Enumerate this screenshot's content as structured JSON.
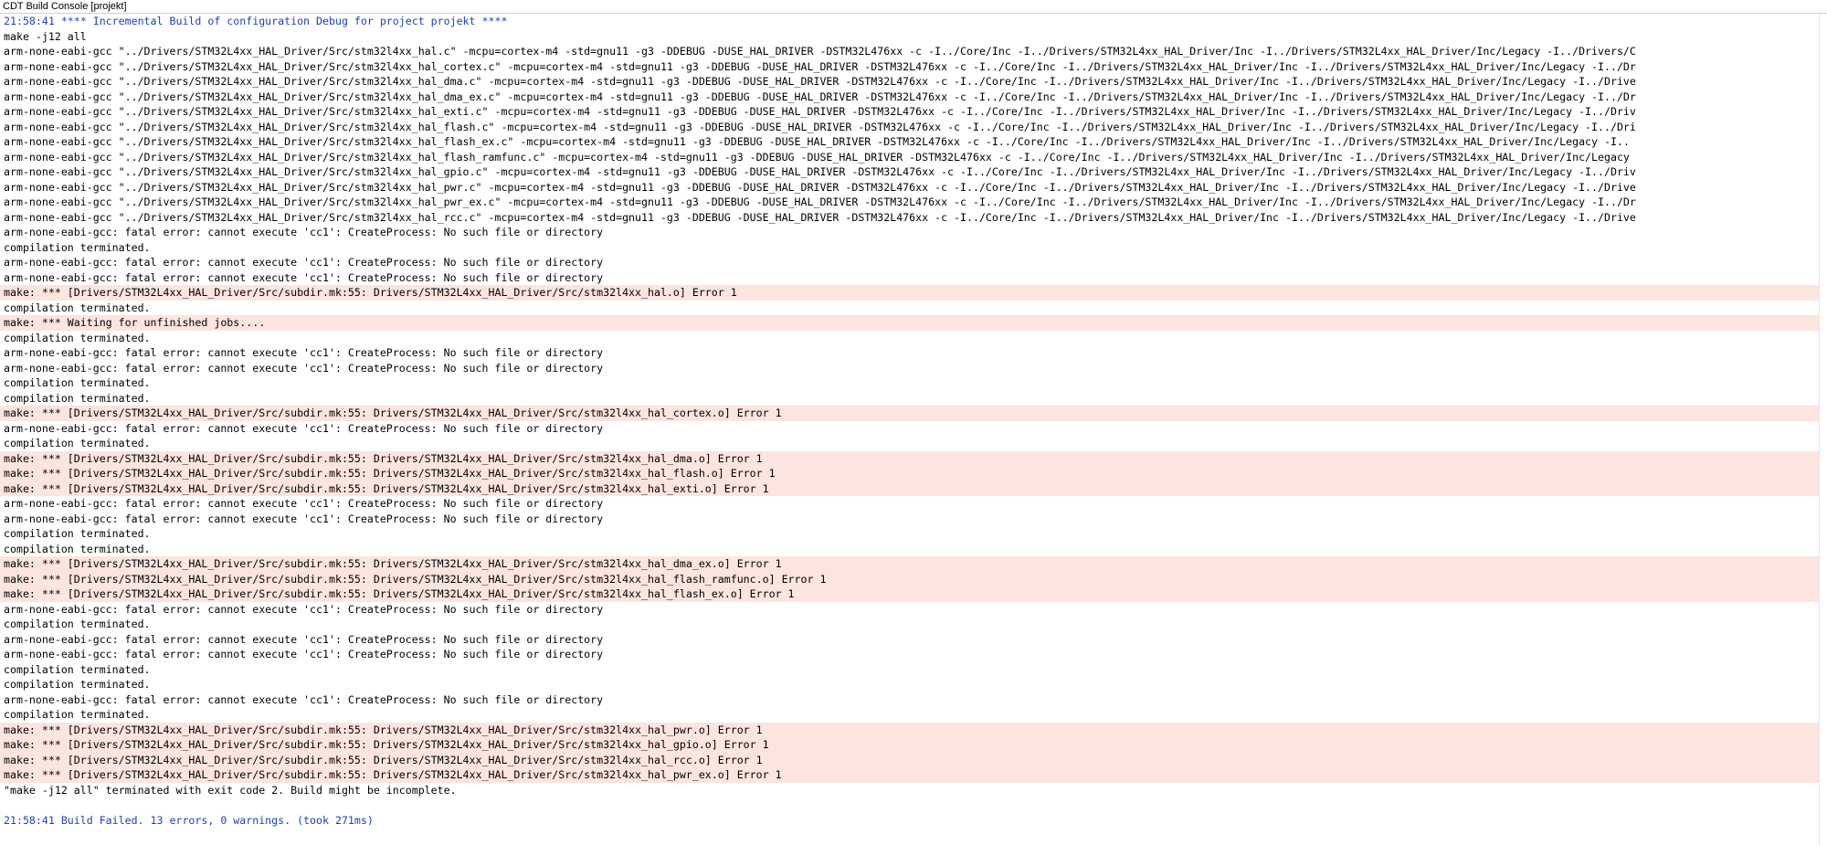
{
  "window": {
    "title": "CDT Build Console [projekt]"
  },
  "console": {
    "lines": [
      {
        "text": "21:58:41 **** Incremental Build of configuration Debug for project projekt ****",
        "kind": "info"
      },
      {
        "text": "make -j12 all",
        "kind": "normal"
      },
      {
        "text": "arm-none-eabi-gcc \"../Drivers/STM32L4xx_HAL_Driver/Src/stm32l4xx_hal.c\" -mcpu=cortex-m4 -std=gnu11 -g3 -DDEBUG -DUSE_HAL_DRIVER -DSTM32L476xx -c -I../Core/Inc -I../Drivers/STM32L4xx_HAL_Driver/Inc -I../Drivers/STM32L4xx_HAL_Driver/Inc/Legacy -I../Drivers/C",
        "kind": "normal"
      },
      {
        "text": "arm-none-eabi-gcc \"../Drivers/STM32L4xx_HAL_Driver/Src/stm32l4xx_hal_cortex.c\" -mcpu=cortex-m4 -std=gnu11 -g3 -DDEBUG -DUSE_HAL_DRIVER -DSTM32L476xx -c -I../Core/Inc -I../Drivers/STM32L4xx_HAL_Driver/Inc -I../Drivers/STM32L4xx_HAL_Driver/Inc/Legacy -I../Dr",
        "kind": "normal"
      },
      {
        "text": "arm-none-eabi-gcc \"../Drivers/STM32L4xx_HAL_Driver/Src/stm32l4xx_hal_dma.c\" -mcpu=cortex-m4 -std=gnu11 -g3 -DDEBUG -DUSE_HAL_DRIVER -DSTM32L476xx -c -I../Core/Inc -I../Drivers/STM32L4xx_HAL_Driver/Inc -I../Drivers/STM32L4xx_HAL_Driver/Inc/Legacy -I../Drive",
        "kind": "normal"
      },
      {
        "text": "arm-none-eabi-gcc \"../Drivers/STM32L4xx_HAL_Driver/Src/stm32l4xx_hal_dma_ex.c\" -mcpu=cortex-m4 -std=gnu11 -g3 -DDEBUG -DUSE_HAL_DRIVER -DSTM32L476xx -c -I../Core/Inc -I../Drivers/STM32L4xx_HAL_Driver/Inc -I../Drivers/STM32L4xx_HAL_Driver/Inc/Legacy -I../Dr",
        "kind": "normal"
      },
      {
        "text": "arm-none-eabi-gcc \"../Drivers/STM32L4xx_HAL_Driver/Src/stm32l4xx_hal_exti.c\" -mcpu=cortex-m4 -std=gnu11 -g3 -DDEBUG -DUSE_HAL_DRIVER -DSTM32L476xx -c -I../Core/Inc -I../Drivers/STM32L4xx_HAL_Driver/Inc -I../Drivers/STM32L4xx_HAL_Driver/Inc/Legacy -I../Driv",
        "kind": "normal"
      },
      {
        "text": "arm-none-eabi-gcc \"../Drivers/STM32L4xx_HAL_Driver/Src/stm32l4xx_hal_flash.c\" -mcpu=cortex-m4 -std=gnu11 -g3 -DDEBUG -DUSE_HAL_DRIVER -DSTM32L476xx -c -I../Core/Inc -I../Drivers/STM32L4xx_HAL_Driver/Inc -I../Drivers/STM32L4xx_HAL_Driver/Inc/Legacy -I../Dri",
        "kind": "normal"
      },
      {
        "text": "arm-none-eabi-gcc \"../Drivers/STM32L4xx_HAL_Driver/Src/stm32l4xx_hal_flash_ex.c\" -mcpu=cortex-m4 -std=gnu11 -g3 -DDEBUG -DUSE_HAL_DRIVER -DSTM32L476xx -c -I../Core/Inc -I../Drivers/STM32L4xx_HAL_Driver/Inc -I../Drivers/STM32L4xx_HAL_Driver/Inc/Legacy -I..",
        "kind": "normal"
      },
      {
        "text": "arm-none-eabi-gcc \"../Drivers/STM32L4xx_HAL_Driver/Src/stm32l4xx_hal_flash_ramfunc.c\" -mcpu=cortex-m4 -std=gnu11 -g3 -DDEBUG -DUSE_HAL_DRIVER -DSTM32L476xx -c -I../Core/Inc -I../Drivers/STM32L4xx_HAL_Driver/Inc -I../Drivers/STM32L4xx_HAL_Driver/Inc/Legacy",
        "kind": "normal"
      },
      {
        "text": "arm-none-eabi-gcc \"../Drivers/STM32L4xx_HAL_Driver/Src/stm32l4xx_hal_gpio.c\" -mcpu=cortex-m4 -std=gnu11 -g3 -DDEBUG -DUSE_HAL_DRIVER -DSTM32L476xx -c -I../Core/Inc -I../Drivers/STM32L4xx_HAL_Driver/Inc -I../Drivers/STM32L4xx_HAL_Driver/Inc/Legacy -I../Driv",
        "kind": "normal"
      },
      {
        "text": "arm-none-eabi-gcc \"../Drivers/STM32L4xx_HAL_Driver/Src/stm32l4xx_hal_pwr.c\" -mcpu=cortex-m4 -std=gnu11 -g3 -DDEBUG -DUSE_HAL_DRIVER -DSTM32L476xx -c -I../Core/Inc -I../Drivers/STM32L4xx_HAL_Driver/Inc -I../Drivers/STM32L4xx_HAL_Driver/Inc/Legacy -I../Drive",
        "kind": "normal"
      },
      {
        "text": "arm-none-eabi-gcc \"../Drivers/STM32L4xx_HAL_Driver/Src/stm32l4xx_hal_pwr_ex.c\" -mcpu=cortex-m4 -std=gnu11 -g3 -DDEBUG -DUSE_HAL_DRIVER -DSTM32L476xx -c -I../Core/Inc -I../Drivers/STM32L4xx_HAL_Driver/Inc -I../Drivers/STM32L4xx_HAL_Driver/Inc/Legacy -I../Dr",
        "kind": "normal"
      },
      {
        "text": "arm-none-eabi-gcc \"../Drivers/STM32L4xx_HAL_Driver/Src/stm32l4xx_hal_rcc.c\" -mcpu=cortex-m4 -std=gnu11 -g3 -DDEBUG -DUSE_HAL_DRIVER -DSTM32L476xx -c -I../Core/Inc -I../Drivers/STM32L4xx_HAL_Driver/Inc -I../Drivers/STM32L4xx_HAL_Driver/Inc/Legacy -I../Drive",
        "kind": "normal"
      },
      {
        "text": "arm-none-eabi-gcc: fatal error: cannot execute 'cc1': CreateProcess: No such file or directory",
        "kind": "normal"
      },
      {
        "text": "compilation terminated.",
        "kind": "normal"
      },
      {
        "text": "arm-none-eabi-gcc: fatal error: cannot execute 'cc1': CreateProcess: No such file or directory",
        "kind": "normal"
      },
      {
        "text": "arm-none-eabi-gcc: fatal error: cannot execute 'cc1': CreateProcess: No such file or directory",
        "kind": "normal"
      },
      {
        "text": "make: *** [Drivers/STM32L4xx_HAL_Driver/Src/subdir.mk:55: Drivers/STM32L4xx_HAL_Driver/Src/stm32l4xx_hal.o] Error 1",
        "kind": "err"
      },
      {
        "text": "compilation terminated.",
        "kind": "normal"
      },
      {
        "text": "make: *** Waiting for unfinished jobs....",
        "kind": "err"
      },
      {
        "text": "compilation terminated.",
        "kind": "normal"
      },
      {
        "text": "arm-none-eabi-gcc: fatal error: cannot execute 'cc1': CreateProcess: No such file or directory",
        "kind": "normal"
      },
      {
        "text": "arm-none-eabi-gcc: fatal error: cannot execute 'cc1': CreateProcess: No such file or directory",
        "kind": "normal"
      },
      {
        "text": "compilation terminated.",
        "kind": "normal"
      },
      {
        "text": "compilation terminated.",
        "kind": "normal"
      },
      {
        "text": "make: *** [Drivers/STM32L4xx_HAL_Driver/Src/subdir.mk:55: Drivers/STM32L4xx_HAL_Driver/Src/stm32l4xx_hal_cortex.o] Error 1",
        "kind": "err"
      },
      {
        "text": "arm-none-eabi-gcc: fatal error: cannot execute 'cc1': CreateProcess: No such file or directory",
        "kind": "normal"
      },
      {
        "text": "compilation terminated.",
        "kind": "normal"
      },
      {
        "text": "make: *** [Drivers/STM32L4xx_HAL_Driver/Src/subdir.mk:55: Drivers/STM32L4xx_HAL_Driver/Src/stm32l4xx_hal_dma.o] Error 1",
        "kind": "err"
      },
      {
        "text": "make: *** [Drivers/STM32L4xx_HAL_Driver/Src/subdir.mk:55: Drivers/STM32L4xx_HAL_Driver/Src/stm32l4xx_hal_flash.o] Error 1",
        "kind": "err"
      },
      {
        "text": "make: *** [Drivers/STM32L4xx_HAL_Driver/Src/subdir.mk:55: Drivers/STM32L4xx_HAL_Driver/Src/stm32l4xx_hal_exti.o] Error 1",
        "kind": "err"
      },
      {
        "text": "arm-none-eabi-gcc: fatal error: cannot execute 'cc1': CreateProcess: No such file or directory",
        "kind": "normal"
      },
      {
        "text": "arm-none-eabi-gcc: fatal error: cannot execute 'cc1': CreateProcess: No such file or directory",
        "kind": "normal"
      },
      {
        "text": "compilation terminated.",
        "kind": "normal"
      },
      {
        "text": "compilation terminated.",
        "kind": "normal"
      },
      {
        "text": "make: *** [Drivers/STM32L4xx_HAL_Driver/Src/subdir.mk:55: Drivers/STM32L4xx_HAL_Driver/Src/stm32l4xx_hal_dma_ex.o] Error 1",
        "kind": "err"
      },
      {
        "text": "make: *** [Drivers/STM32L4xx_HAL_Driver/Src/subdir.mk:55: Drivers/STM32L4xx_HAL_Driver/Src/stm32l4xx_hal_flash_ramfunc.o] Error 1",
        "kind": "err"
      },
      {
        "text": "make: *** [Drivers/STM32L4xx_HAL_Driver/Src/subdir.mk:55: Drivers/STM32L4xx_HAL_Driver/Src/stm32l4xx_hal_flash_ex.o] Error 1",
        "kind": "err"
      },
      {
        "text": "arm-none-eabi-gcc: fatal error: cannot execute 'cc1': CreateProcess: No such file or directory",
        "kind": "normal"
      },
      {
        "text": "compilation terminated.",
        "kind": "normal"
      },
      {
        "text": "arm-none-eabi-gcc: fatal error: cannot execute 'cc1': CreateProcess: No such file or directory",
        "kind": "normal"
      },
      {
        "text": "arm-none-eabi-gcc: fatal error: cannot execute 'cc1': CreateProcess: No such file or directory",
        "kind": "normal"
      },
      {
        "text": "compilation terminated.",
        "kind": "normal"
      },
      {
        "text": "compilation terminated.",
        "kind": "normal"
      },
      {
        "text": "arm-none-eabi-gcc: fatal error: cannot execute 'cc1': CreateProcess: No such file or directory",
        "kind": "normal"
      },
      {
        "text": "compilation terminated.",
        "kind": "normal"
      },
      {
        "text": "make: *** [Drivers/STM32L4xx_HAL_Driver/Src/subdir.mk:55: Drivers/STM32L4xx_HAL_Driver/Src/stm32l4xx_hal_pwr.o] Error 1",
        "kind": "err"
      },
      {
        "text": "make: *** [Drivers/STM32L4xx_HAL_Driver/Src/subdir.mk:55: Drivers/STM32L4xx_HAL_Driver/Src/stm32l4xx_hal_gpio.o] Error 1",
        "kind": "err"
      },
      {
        "text": "make: *** [Drivers/STM32L4xx_HAL_Driver/Src/subdir.mk:55: Drivers/STM32L4xx_HAL_Driver/Src/stm32l4xx_hal_rcc.o] Error 1",
        "kind": "err"
      },
      {
        "text": "make: *** [Drivers/STM32L4xx_HAL_Driver/Src/subdir.mk:55: Drivers/STM32L4xx_HAL_Driver/Src/stm32l4xx_hal_pwr_ex.o] Error 1",
        "kind": "err"
      },
      {
        "text": "\"make -j12 all\" terminated with exit code 2. Build might be incomplete.",
        "kind": "normal"
      },
      {
        "text": "",
        "kind": "normal"
      },
      {
        "text": "21:58:41 Build Failed. 13 errors, 0 warnings. (took 271ms)",
        "kind": "info"
      }
    ]
  },
  "colors": {
    "info_text": "#1f3fb8",
    "error_highlight": "#fce4df",
    "normal_text": "#000000"
  }
}
